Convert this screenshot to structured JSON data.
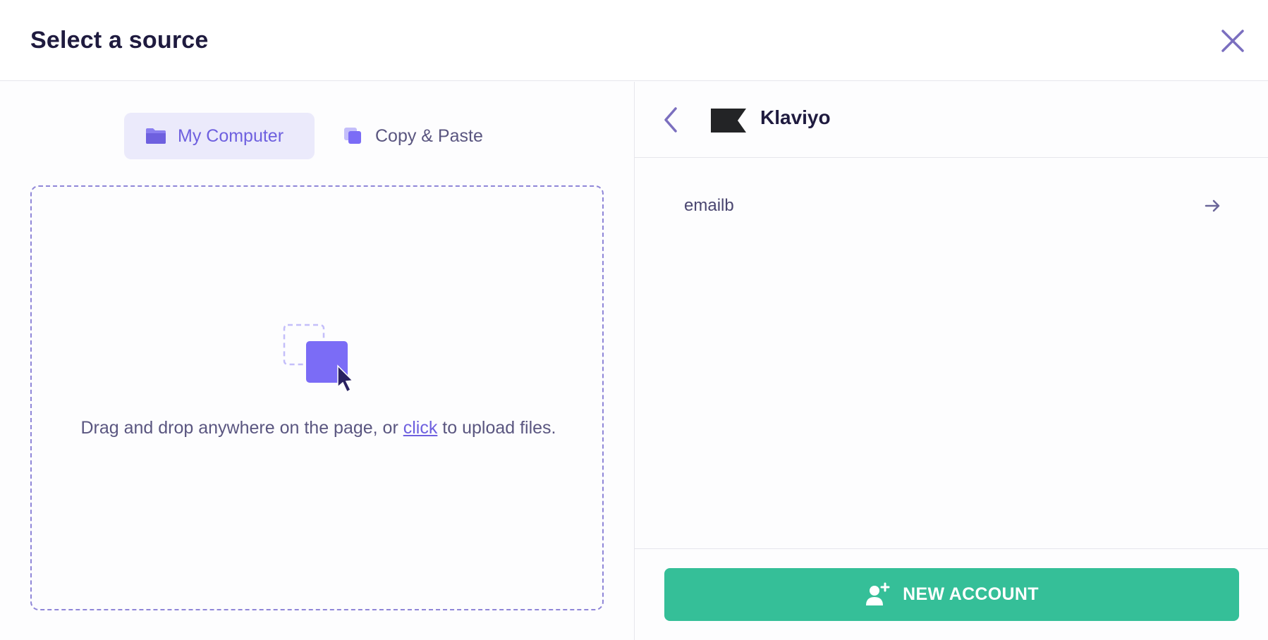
{
  "modal": {
    "title": "Select a source"
  },
  "tabs": [
    {
      "label": "My Computer",
      "icon": "folder-icon",
      "active": true
    },
    {
      "label": "Copy & Paste",
      "icon": "copy-icon",
      "active": false
    }
  ],
  "dropzone": {
    "text_before": "Drag and drop anywhere on the page, or ",
    "link": "click",
    "text_after": " to upload files."
  },
  "source": {
    "name": "Klaviyo",
    "accounts": [
      {
        "name": "emailb"
      }
    ],
    "new_account_label": "NEW ACCOUNT"
  },
  "colors": {
    "accent": "#6e60df",
    "green": "#35bf98",
    "text_dark": "#1f1b3f"
  }
}
